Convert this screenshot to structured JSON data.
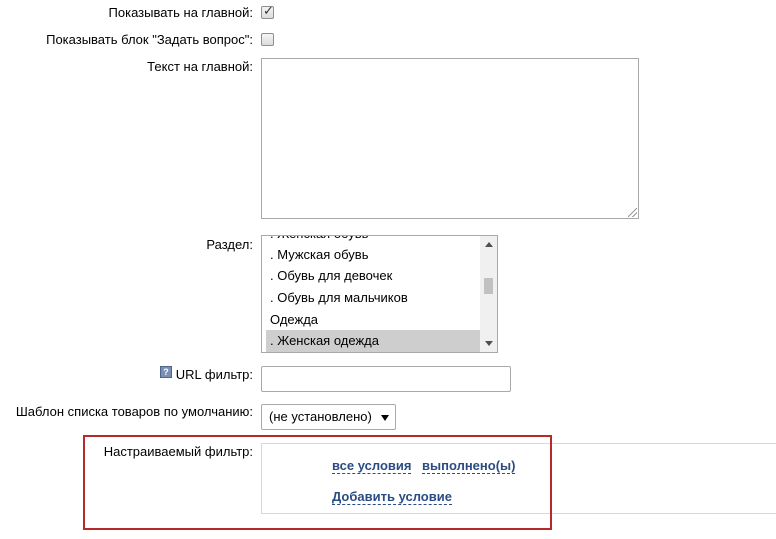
{
  "form": {
    "show_on_main": {
      "label": "Показывать на главной:",
      "checked": true
    },
    "show_question_block": {
      "label": "Показывать блок \"Задать вопрос\":",
      "checked": false
    },
    "main_text": {
      "label": "Текст на главной:",
      "value": ""
    },
    "section": {
      "label": "Раздел:",
      "options": [
        ". Женская обувь",
        ". Мужская обувь",
        ". Обувь для девочек",
        ". Обувь для мальчиков",
        "Одежда",
        ". Женская одежда"
      ],
      "selected": ". Женская одежда"
    },
    "url_filter": {
      "label": "URL фильтр:",
      "value": "",
      "help_icon": "question-icon"
    },
    "template": {
      "label": "Шаблон списка товаров по умолчанию:",
      "selected": "(не установлено)"
    },
    "custom_filter": {
      "label": "Настраиваемый фильтр:",
      "all_conditions": "все условия",
      "fulfilled": "выполнено(ы)",
      "add_condition": "Добавить условие"
    }
  },
  "colors": {
    "link": "#2b4c83",
    "highlight_border": "#b82a2a",
    "selected_option": "#cecece"
  }
}
